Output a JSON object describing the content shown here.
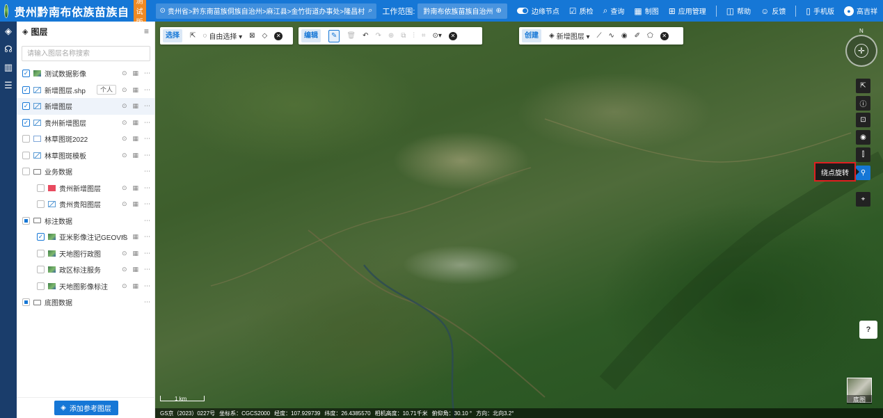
{
  "header": {
    "app_title": "贵州黔南布依族苗族自",
    "trial_badge": "测试版",
    "location_path": "贵州省>黔东南苗族侗族自治州>麻江县>金竹街道办事处>隆昌村",
    "work_range_label": "工作范围:",
    "work_range_value": "黔南布依族苗族自治州",
    "actions": [
      {
        "label": "边缘节点",
        "icon": "toggle-icon"
      },
      {
        "label": "质检",
        "icon": "inspect-icon"
      },
      {
        "label": "查询",
        "icon": "search-icon"
      },
      {
        "label": "制图",
        "icon": "map-icon"
      },
      {
        "label": "应用管理",
        "icon": "grid-icon"
      },
      {
        "label": "帮助",
        "icon": "help-icon"
      },
      {
        "label": "反馈",
        "icon": "feedback-icon"
      },
      {
        "label": "手机版",
        "icon": "phone-icon"
      },
      {
        "label": "高吉祥",
        "icon": "user-icon"
      }
    ]
  },
  "panel": {
    "title": "图层",
    "search_placeholder": "请输入图层名称搜索",
    "add_ref_button": "添加参考图层",
    "personal_tag": "个人",
    "layers": [
      {
        "name": "测试数据影像",
        "checked": true,
        "icon": "img",
        "indent": 0,
        "actions": true
      },
      {
        "name": "新增图层.shp",
        "checked": true,
        "icon": "vec",
        "indent": 0,
        "actions": true,
        "tag": true
      },
      {
        "name": "新增图层",
        "checked": true,
        "icon": "vec",
        "indent": 0,
        "actions": true,
        "selected": true
      },
      {
        "name": "贵州新增图层",
        "checked": true,
        "icon": "vec",
        "indent": 0,
        "actions": true
      },
      {
        "name": "林草图斑2022",
        "checked": false,
        "icon": "empty",
        "indent": 0,
        "actions": true
      },
      {
        "name": "林草图斑模板",
        "checked": false,
        "icon": "vec",
        "indent": 0,
        "actions": true
      },
      {
        "name": "业务数据",
        "checked": false,
        "icon": "folder",
        "indent": 0,
        "actions": false
      },
      {
        "name": "贵州新增图层",
        "checked": false,
        "icon": "red",
        "indent": 1,
        "actions": true
      },
      {
        "name": "贵州贵阳图层",
        "checked": false,
        "icon": "vec",
        "indent": 1,
        "actions": true
      },
      {
        "name": "标注数据",
        "checked": "partial",
        "icon": "folder",
        "indent": 0,
        "actions": false
      },
      {
        "name": "亚米影像注记GEOVIS",
        "checked": true,
        "icon": "img",
        "indent": 1,
        "actions": true
      },
      {
        "name": "天地图行政图",
        "checked": false,
        "icon": "img",
        "indent": 1,
        "actions": true
      },
      {
        "name": "政区标注服务",
        "checked": false,
        "icon": "img",
        "indent": 1,
        "actions": true
      },
      {
        "name": "天地图影像标注",
        "checked": false,
        "icon": "img",
        "indent": 1,
        "actions": true
      },
      {
        "name": "底图数据",
        "checked": "partial",
        "icon": "folder",
        "indent": 0,
        "actions": false
      }
    ]
  },
  "toolbars": {
    "select": {
      "label": "选择",
      "free_select": "自由选择 ▾"
    },
    "edit": {
      "label": "编辑"
    },
    "create": {
      "label": "创建",
      "new_layer": "新增图层 ▾"
    }
  },
  "map": {
    "compass_north": "N",
    "tooltip": "绕点旋转",
    "help_badge": "?",
    "basemap_label": "底图",
    "scale_label": "1 km",
    "status": {
      "approval": "GS京（2023）0227号",
      "crs": "坐标系：CGCS2000",
      "lon": "经度：107.929739",
      "lat": "纬度：26.4385570",
      "height": "相机高度：10.71千米",
      "pitch": "俯仰角：30.10 °",
      "heading": "方向：北向3.2°"
    }
  }
}
